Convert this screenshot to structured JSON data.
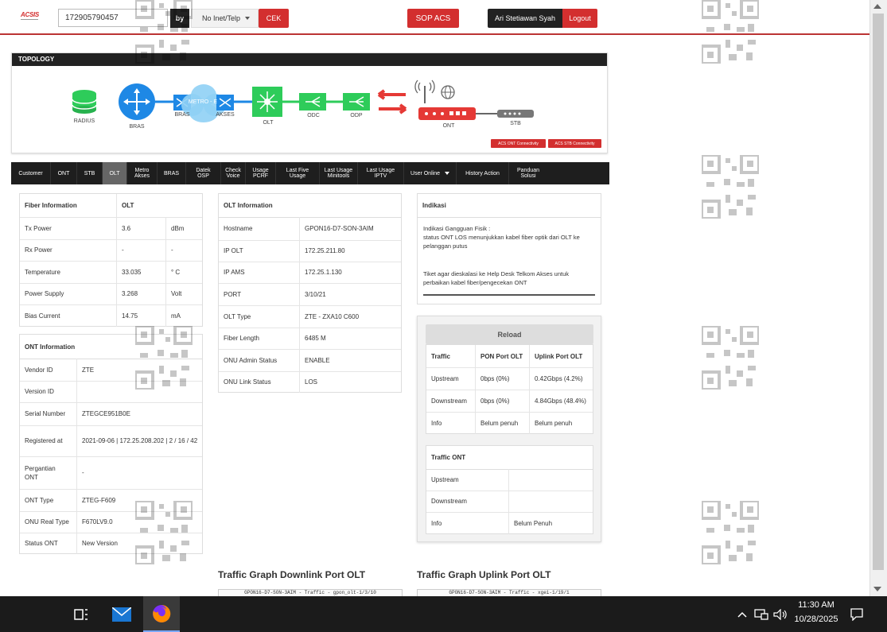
{
  "header": {
    "logo": "ACSIS",
    "search_value": "172905790457",
    "by_label": "by",
    "type_select": "No Inet/Telp",
    "cek_label": "CEK",
    "sop_label": "SOP ACS",
    "user_name": "Ari Stetiawan Syah",
    "logout_label": "Logout"
  },
  "topology": {
    "title": "TOPOLOGY",
    "nodes": {
      "radius": "RADIUS",
      "bras": "BRAS",
      "bras2": "BRAS",
      "metro": "METRO - E",
      "akses": "AKSES",
      "olt": "OLT",
      "odc": "ODC",
      "odp": "ODP",
      "ont": "ONT",
      "stb": "STB"
    },
    "btn_ont": "ACS ONT Connectivity",
    "btn_stb": "ACS STB Connectivity"
  },
  "tabs": [
    {
      "label": "Customer"
    },
    {
      "label": "ONT"
    },
    {
      "label": "STB"
    },
    {
      "label": "OLT"
    },
    {
      "l1": "Metro",
      "l2": "Akses"
    },
    {
      "label": "BRAS"
    },
    {
      "l1": "Datek",
      "l2": "OSP"
    },
    {
      "l1": "Check",
      "l2": "Voice"
    },
    {
      "l1": "Usage",
      "l2": "PCRF"
    },
    {
      "l1": "Last Five",
      "l2": "Usage"
    },
    {
      "l1": "Last Usage",
      "l2": "Minitools"
    },
    {
      "l1": "Last Usage",
      "l2": "IPTV"
    },
    {
      "label": "User Online"
    },
    {
      "label": "History Action"
    },
    {
      "l1": "Panduan",
      "l2": "Solusi"
    }
  ],
  "fiber": {
    "header": [
      "Fiber Information",
      "OLT"
    ],
    "rows": [
      [
        "Tx Power",
        "3.6",
        "dBm"
      ],
      [
        "Rx Power",
        "-",
        "-"
      ],
      [
        "Temperature",
        "33.035",
        "° C"
      ],
      [
        "Power Supply",
        "3.268",
        "Volt"
      ],
      [
        "Bias Current",
        "14.75",
        "mA"
      ]
    ]
  },
  "ont_info": {
    "title": "ONT Information",
    "rows": [
      [
        "Vendor ID",
        "ZTE"
      ],
      [
        "Version ID",
        ""
      ],
      [
        "Serial Number",
        "ZTEGCE951B0E"
      ],
      [
        "Registered at",
        "2021-09-06 | 172.25.208.202 | 2 / 16 / 42"
      ],
      [
        "Pergantian ONT",
        "-"
      ],
      [
        "ONT Type",
        "ZTEG-F609"
      ],
      [
        "ONU Real Type",
        "F670LV9.0"
      ],
      [
        "Status ONT",
        "New Version"
      ]
    ]
  },
  "olt_info": {
    "title": "OLT Information",
    "rows": [
      [
        "Hostname",
        "GPON16-D7-SON-3AIM"
      ],
      [
        "IP OLT",
        "172.25.211.80"
      ],
      [
        "IP AMS",
        "172.25.1.130"
      ],
      [
        "PORT",
        "3/10/21"
      ],
      [
        "OLT Type",
        "ZTE - ZXA10 C600"
      ],
      [
        "Fiber Length",
        "6485 M"
      ],
      [
        "ONU Admin Status",
        "ENABLE"
      ],
      [
        "ONU Link Status",
        "LOS"
      ]
    ]
  },
  "indikasi": {
    "title": "Indikasi",
    "line1": "Indikasi Gangguan Fisik :",
    "line2": "status ONT LOS menunjukkan kabel fiber optik dari OLT ke pelanggan putus",
    "line3": "Tiket agar dieskalasi ke Help Desk Telkom Akses untuk perbaikan kabel fiber/pengecekan ONT"
  },
  "traffic": {
    "reload_label": "Reload",
    "header": [
      "Traffic",
      "PON Port OLT",
      "Uplink Port OLT"
    ],
    "rows": [
      [
        "Upstream",
        "0bps (0%)",
        "0.42Gbps (4.2%)"
      ],
      [
        "Downstream",
        "0bps (0%)",
        "4.84Gbps (48.4%)"
      ],
      [
        "Info",
        "Belum penuh",
        "Belum penuh"
      ]
    ]
  },
  "traffic_ont": {
    "title": "Traffic ONT",
    "rows": [
      [
        "Upstream",
        ""
      ],
      [
        "Downstream",
        ""
      ],
      [
        "Info",
        "Belum Penuh"
      ]
    ]
  },
  "graphs": {
    "downlink_title": "Traffic Graph Downlink Port OLT",
    "uplink_title": "Traffic Graph Uplink Port OLT",
    "downlink_caption": "GPON16-D7-SON-3AIM - Traffic - gpon_olt-1/3/10",
    "uplink_caption": "GPON16-D7-SON-3AIM - Traffic - xgei-1/19/1"
  },
  "taskbar": {
    "time": "11:30 AM",
    "date": "10/28/2025"
  },
  "colors": {
    "accent_red": "#d32f2f",
    "dark": "#1e1e1e",
    "topo_blue": "#1e88e5",
    "topo_green": "#2ecc5a"
  }
}
